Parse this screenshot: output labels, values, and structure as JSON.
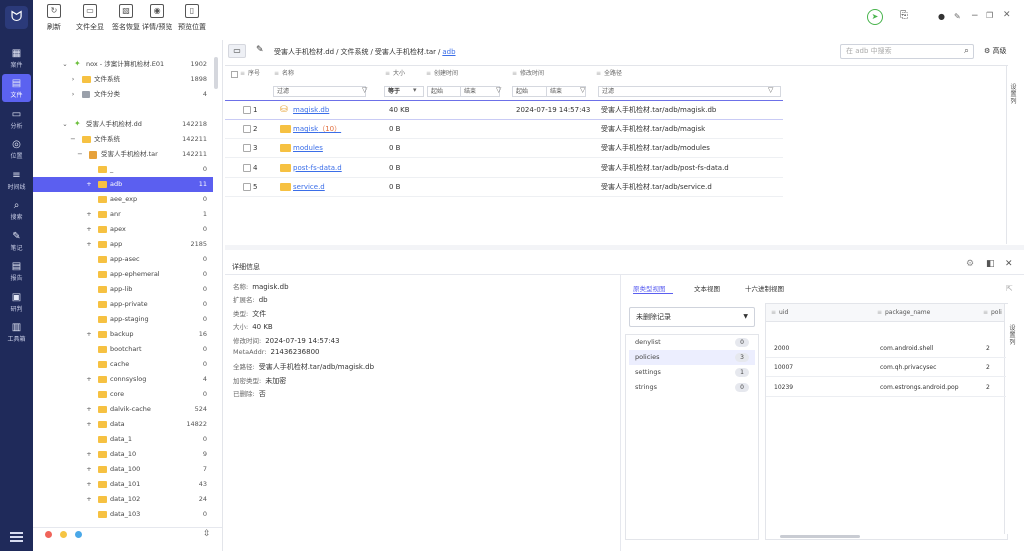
{
  "toolbar": {
    "buttons": [
      {
        "label": "刷新",
        "icon": "refresh-icon",
        "glyph": "↻"
      },
      {
        "label": "文件全显",
        "icon": "folder-icon",
        "glyph": "▭"
      },
      {
        "label": "签名恢复",
        "icon": "signature-icon",
        "glyph": "▧"
      },
      {
        "label": "详情/预览",
        "icon": "eye-off-icon",
        "glyph": "◉"
      },
      {
        "label": "预览位置",
        "icon": "preview-layout-icon",
        "glyph": "▯"
      }
    ]
  },
  "rail": {
    "items": [
      {
        "label": "案件",
        "icon": "case-icon",
        "glyph": "▦"
      },
      {
        "label": "文件",
        "icon": "file-icon",
        "glyph": "▤"
      },
      {
        "label": "分析",
        "icon": "analysis-icon",
        "glyph": "▭"
      },
      {
        "label": "位置",
        "icon": "location-icon",
        "glyph": "◎"
      },
      {
        "label": "时间线",
        "icon": "timeline-icon",
        "glyph": "≡"
      },
      {
        "label": "搜索",
        "icon": "search-icon",
        "glyph": "⌕"
      },
      {
        "label": "笔记",
        "icon": "note-icon",
        "glyph": "✎"
      },
      {
        "label": "报告",
        "icon": "report-icon",
        "glyph": "▤"
      },
      {
        "label": "研判",
        "icon": "judge-icon",
        "glyph": "▣"
      },
      {
        "label": "工具箱",
        "icon": "toolbox-icon",
        "glyph": "▥"
      }
    ]
  },
  "tree": [
    {
      "pm": "⌄",
      "icon": "and",
      "label": "nox - 涉案计算机检材.E01",
      "count": "1902"
    },
    {
      "pm": "›",
      "icon": "folder",
      "label": "文件系统",
      "count": "1898"
    },
    {
      "pm": "›",
      "icon": "gray",
      "label": "文件分类",
      "count": "4"
    },
    {
      "pm": "",
      "icon": "",
      "label": "",
      "count": ""
    },
    {
      "pm": "⌄",
      "icon": "and",
      "label": "受害人手机检材.dd",
      "count": "142218"
    },
    {
      "pm": "−",
      "icon": "folder",
      "label": "文件系统",
      "count": "142211"
    },
    {
      "pm": "−",
      "icon": "img",
      "label": "受害人手机检材.tar",
      "count": "142211"
    },
    {
      "pm": "",
      "icon": "folder",
      "label": "_",
      "count": "0"
    },
    {
      "pm": "+",
      "icon": "folder",
      "label": "adb",
      "count": "11",
      "selected": true
    },
    {
      "pm": "",
      "icon": "folder",
      "label": "aee_exp",
      "count": "0"
    },
    {
      "pm": "+",
      "icon": "folder",
      "label": "anr",
      "count": "1"
    },
    {
      "pm": "+",
      "icon": "folder",
      "label": "apex",
      "count": "0"
    },
    {
      "pm": "+",
      "icon": "folder",
      "label": "app",
      "count": "2185"
    },
    {
      "pm": "",
      "icon": "folder",
      "label": "app-asec",
      "count": "0"
    },
    {
      "pm": "",
      "icon": "folder",
      "label": "app-ephemeral",
      "count": "0"
    },
    {
      "pm": "",
      "icon": "folder",
      "label": "app-lib",
      "count": "0"
    },
    {
      "pm": "",
      "icon": "folder",
      "label": "app-private",
      "count": "0"
    },
    {
      "pm": "",
      "icon": "folder",
      "label": "app-staging",
      "count": "0"
    },
    {
      "pm": "+",
      "icon": "folder",
      "label": "backup",
      "count": "16"
    },
    {
      "pm": "",
      "icon": "folder",
      "label": "bootchart",
      "count": "0"
    },
    {
      "pm": "",
      "icon": "folder",
      "label": "cache",
      "count": "0"
    },
    {
      "pm": "+",
      "icon": "folder",
      "label": "connsyslog",
      "count": "4"
    },
    {
      "pm": "",
      "icon": "folder",
      "label": "core",
      "count": "0"
    },
    {
      "pm": "+",
      "icon": "folder",
      "label": "dalvik-cache",
      "count": "524"
    },
    {
      "pm": "+",
      "icon": "folder",
      "label": "data",
      "count": "14822"
    },
    {
      "pm": "",
      "icon": "folder",
      "label": "data_1",
      "count": "0"
    },
    {
      "pm": "+",
      "icon": "folder",
      "label": "data_10",
      "count": "9"
    },
    {
      "pm": "+",
      "icon": "folder",
      "label": "data_100",
      "count": "7"
    },
    {
      "pm": "+",
      "icon": "folder",
      "label": "data_101",
      "count": "43"
    },
    {
      "pm": "+",
      "icon": "folder",
      "label": "data_102",
      "count": "24"
    },
    {
      "pm": "",
      "icon": "folder",
      "label": "data_103",
      "count": "0"
    }
  ],
  "path": {
    "crumbs": [
      "受害人手机检材.dd",
      "/",
      "文件系统",
      "/",
      "受害人手机检材.tar",
      "/"
    ],
    "current": "adb",
    "search_placeholder": "在 adb 中搜索",
    "advanced": "高级"
  },
  "table": {
    "headers": [
      "序号",
      "名称",
      "大小",
      "创建时间",
      "修改时间",
      "全路径"
    ],
    "filters": {
      "name": "过滤",
      "size_op": "等于",
      "start": "起始",
      "end": "结束",
      "start2": "起始",
      "end2": "结束",
      "path": "过滤"
    },
    "rows": [
      {
        "idx": "1",
        "name": "magisk.db",
        "extra": "",
        "size": "40 KB",
        "mtime": "2024-07-19 14:57:43",
        "path": "受害人手机检材.tar/adb/magisk.db",
        "type": "db"
      },
      {
        "idx": "2",
        "name": "magisk",
        "extra": "（10）",
        "size": "0 B",
        "mtime": "",
        "path": "受害人手机检材.tar/adb/magisk",
        "type": "folder"
      },
      {
        "idx": "3",
        "name": "modules",
        "extra": "",
        "size": "0 B",
        "mtime": "",
        "path": "受害人手机检材.tar/adb/modules",
        "type": "folder"
      },
      {
        "idx": "4",
        "name": "post-fs-data.d",
        "extra": "",
        "size": "0 B",
        "mtime": "",
        "path": "受害人手机检材.tar/adb/post-fs-data.d",
        "type": "folder"
      },
      {
        "idx": "5",
        "name": "service.d",
        "extra": "",
        "size": "0 B",
        "mtime": "",
        "path": "受害人手机检材.tar/adb/service.d",
        "type": "folder"
      }
    ],
    "settings_tab": "设置列"
  },
  "detail": {
    "title": "详细信息",
    "fields": [
      {
        "k": "名称:",
        "v": "magisk.db"
      },
      {
        "k": "扩展名:",
        "v": "db"
      },
      {
        "k": "类型:",
        "v": "文件"
      },
      {
        "k": "大小:",
        "v": "40 KB"
      },
      {
        "k": "修改时间:",
        "v": "2024-07-19 14:57:43"
      },
      {
        "k": "MetaAddr:",
        "v": "21436236800"
      },
      {
        "k": "全路径:",
        "v": "受害人手机检材.tar/adb/magisk.db"
      },
      {
        "k": "加密类型:",
        "v": "未加密"
      },
      {
        "k": "已删除:",
        "v": "否"
      }
    ],
    "tabs": [
      "原类型视图",
      "文本视图",
      "十六进制视图"
    ],
    "select": "未删除记录",
    "db_tables": [
      {
        "name": "denylist",
        "count": "0"
      },
      {
        "name": "policies",
        "count": "3"
      },
      {
        "name": "settings",
        "count": "1"
      },
      {
        "name": "strings",
        "count": "0"
      }
    ],
    "grid_headers": [
      "uid",
      "package_name",
      "poli"
    ],
    "grid_rows": [
      {
        "uid": "2000",
        "pkg": "com.android.shell",
        "pol": "2"
      },
      {
        "uid": "10007",
        "pkg": "com.qh.privacysec",
        "pol": "2"
      },
      {
        "uid": "10239",
        "pkg": "com.estrongs.android.pop",
        "pol": "2"
      }
    ],
    "settings_tab": "设置列"
  },
  "colors": {
    "rail": "#1f2a5a",
    "accent": "#5b5ff0",
    "folder": "#f6c142",
    "dots": [
      "#f0645a",
      "#f5c443",
      "#4aa8e8"
    ]
  }
}
